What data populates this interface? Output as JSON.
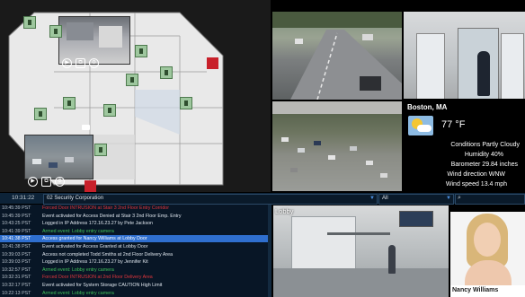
{
  "clock": "10:31:22",
  "site_name": "02 Security Corporation",
  "filter": {
    "selected": "All"
  },
  "search": {
    "placeholder": ""
  },
  "lobby_label": "Lobby",
  "weather": {
    "city": "Boston, MA",
    "temperature": "77 °F",
    "conditions": "Conditions Partly Cloudy",
    "humidity": "Humidity 40%",
    "barometer": "Barometer 29.84 inches",
    "wind_direction": "Wind direction WNW",
    "wind_speed": "Wind speed 13.4 mph"
  },
  "person_name": "Nancy Williams",
  "colors": {
    "accent": "#2f6fcf",
    "alarm": "#e0353c",
    "ok": "#42c25b"
  },
  "log": [
    {
      "time": "10:45:39 PST",
      "msg": "Forced Door INTRUSION at Stair 3 2nd Floor Entry Corridor",
      "status": "red"
    },
    {
      "time": "10:45:39 PST",
      "msg": "Event activated for Access Denied at Stair 3 2nd Floor Emp. Entry",
      "status": "normal"
    },
    {
      "time": "10:43:25 PST",
      "msg": "Logged in IP Address 172.16.23.27 by Pete Jackson",
      "status": "normal"
    },
    {
      "time": "10:41:39 PST",
      "msg": "Armed event: Lobby entry camera",
      "status": "green"
    },
    {
      "time": "10:41:38 PST",
      "msg": "Access granted for Nancy Williams at Lobby Door",
      "status": "selected"
    },
    {
      "time": "10:41:38 PST",
      "msg": "Event activated for Access Granted at Lobby Door",
      "status": "normal"
    },
    {
      "time": "10:39:03 PST",
      "msg": "Access not completed Todd Smiths at 2nd Floor Delivery Area",
      "status": "normal"
    },
    {
      "time": "10:39:03 PST",
      "msg": "Logged in IP Address 172.16.23.27 by Jennifer Kit",
      "status": "normal"
    },
    {
      "time": "10:32:57 PST",
      "msg": "Armed event: Lobby entry camera",
      "status": "green"
    },
    {
      "time": "10:32:31 PST",
      "msg": "Forced Door INTRUSION at 2nd Floor Delivery Area",
      "status": "red"
    },
    {
      "time": "10:32:17 PST",
      "msg": "Event activated for System Storage CAUTION High Limit",
      "status": "normal"
    },
    {
      "time": "10:22:13 PST",
      "msg": "Armed event: Lobby entry camera",
      "status": "green"
    }
  ]
}
